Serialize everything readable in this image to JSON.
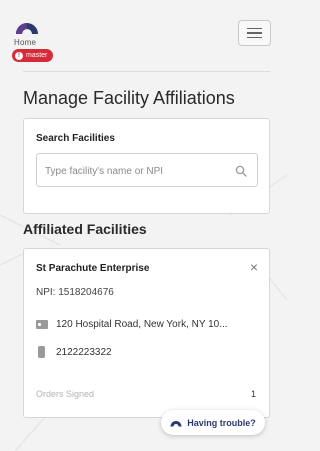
{
  "header": {
    "home_label": "Home",
    "env_badge": {
      "icon": "alert-icon",
      "label": "master"
    },
    "menu_icon": "hamburger-icon"
  },
  "page": {
    "title": "Manage Facility Affiliations"
  },
  "search": {
    "label": "Search Facilities",
    "placeholder": "Type facility's name or NPI",
    "value": "",
    "icon": "search-icon"
  },
  "affiliated": {
    "title": "Affiliated Facilities",
    "facilities": [
      {
        "name": "St Parachute Enterprise",
        "npi": "NPI: 1518204676",
        "address": "120 Hospital Road, New York, NY 10...",
        "phone": "2122223322",
        "orders_label": "Orders Signed",
        "orders_value": "1"
      }
    ]
  },
  "help": {
    "label": "Having trouble?"
  },
  "colors": {
    "brand_navy": "#2c3a6b",
    "brand_purple": "#5b3e8f",
    "badge_red": "#d52b3a",
    "page_bg": "#f3f3f4"
  }
}
